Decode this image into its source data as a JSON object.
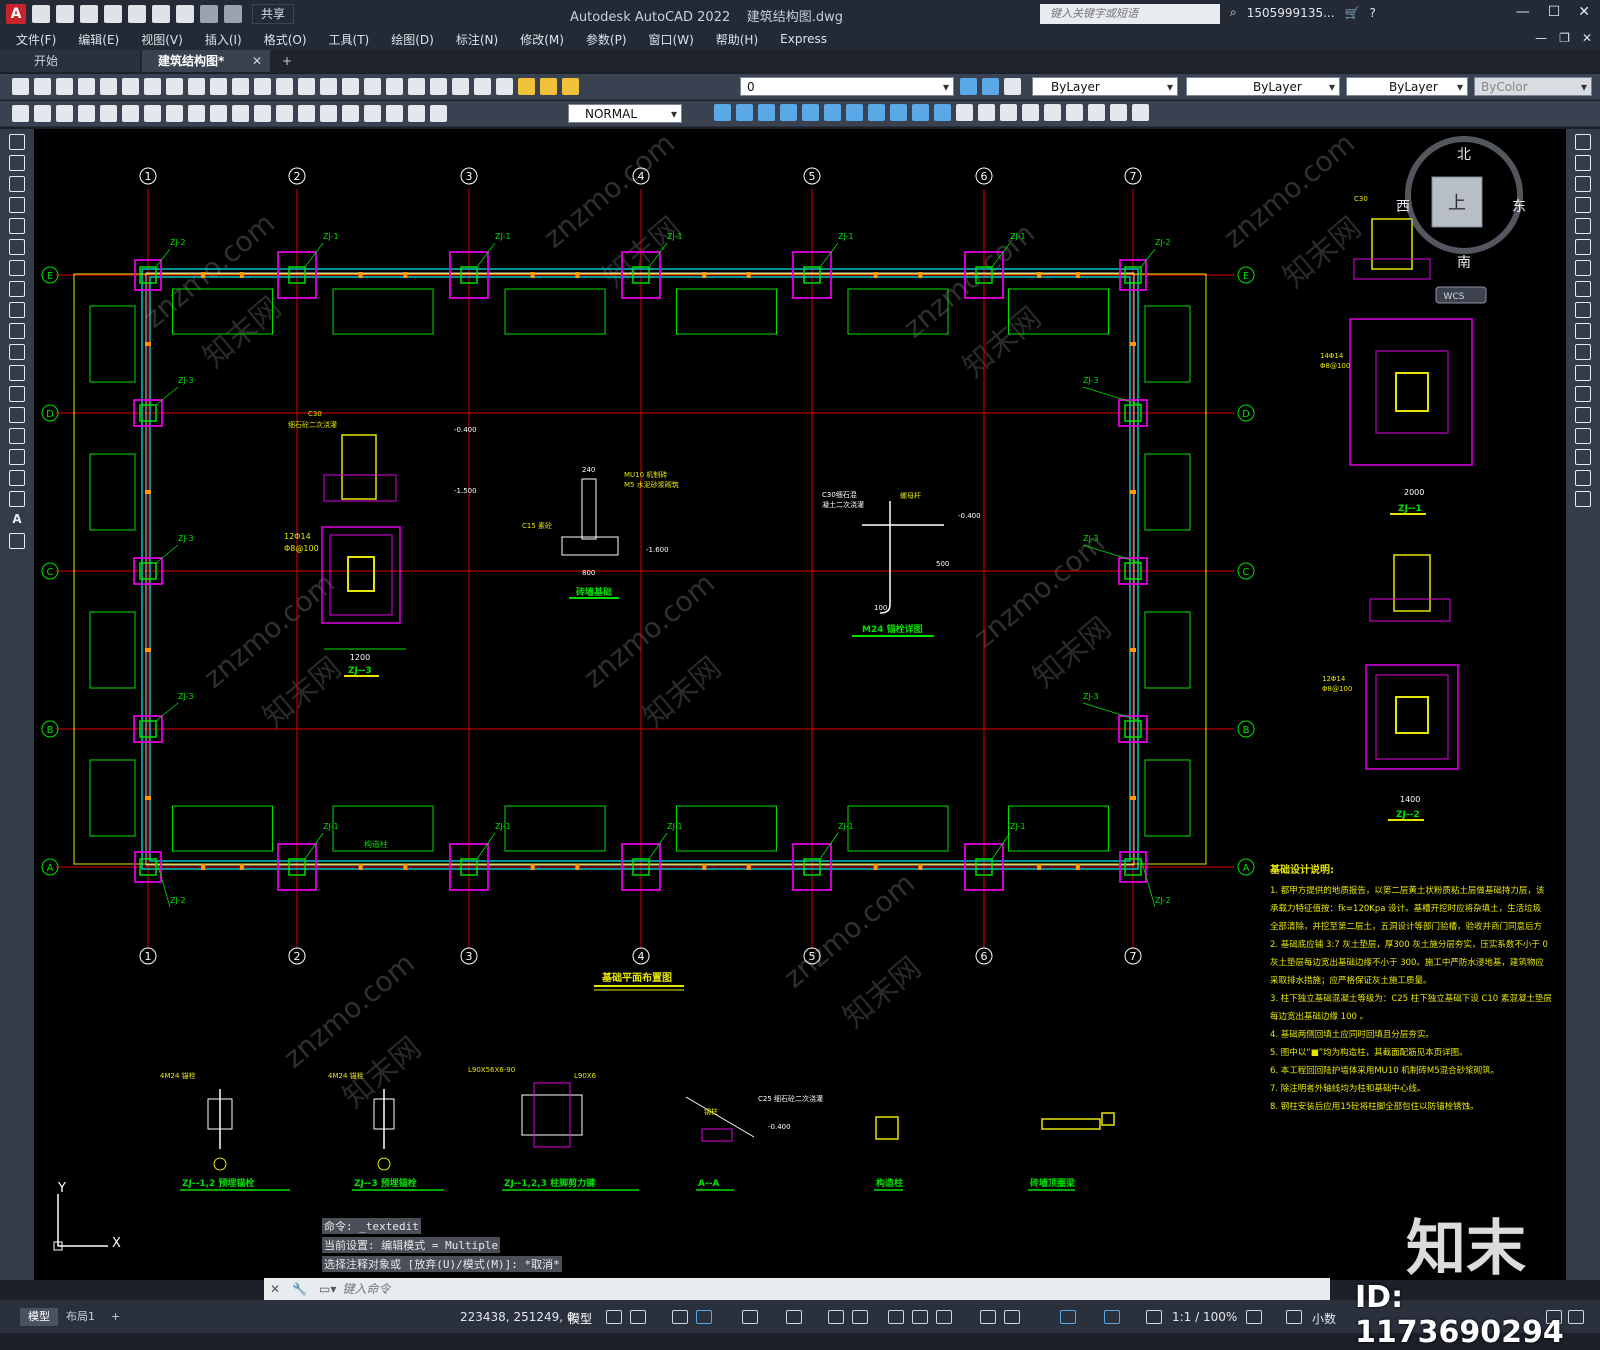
{
  "app": {
    "window_title": "Autodesk AutoCAD 2022",
    "file_name": "建筑结构图.dwg",
    "logo": "A",
    "share": "共享",
    "search_placeholder": "键入关键字或短语",
    "user": "1505999135...",
    "window_controls": [
      "—",
      "☐",
      "✕"
    ]
  },
  "menu": [
    "文件(F)",
    "编辑(E)",
    "视图(V)",
    "插入(I)",
    "格式(O)",
    "工具(T)",
    "绘图(D)",
    "标注(N)",
    "修改(M)",
    "参数(P)",
    "窗口(W)",
    "帮助(H)",
    "Express"
  ],
  "file_tabs": [
    {
      "label": "开始"
    },
    {
      "label": "建筑结构图*",
      "active": true
    }
  ],
  "toolbar": {
    "layer": "0",
    "color": "ByLayer",
    "linetype": "ByLayer",
    "lineweight": "ByLayer",
    "plotstyle": "ByColor",
    "dimstyle": "NORMAL"
  },
  "viewcube": {
    "north": "北",
    "south": "南",
    "east": "东",
    "west": "西",
    "top": "上",
    "wcs": "WCS"
  },
  "drawing": {
    "grid_numbers": [
      "1",
      "2",
      "3",
      "4",
      "5",
      "6",
      "7"
    ],
    "grid_letters": [
      "E",
      "D",
      "C",
      "B",
      "A"
    ],
    "main_title": "基础平面布置图",
    "labels": {
      "zj1": "ZJ-1",
      "zj2": "ZJ-2",
      "zj3": "ZJ-3",
      "gzz": "构造柱"
    },
    "detail_zj3": "ZJ--3",
    "detail_zj1": "ZJ--1",
    "detail_zj2": "ZJ--2",
    "brick_title": "砖墙基础",
    "anchor_title": "M24 锚栓详图",
    "detail_texts": {
      "c30": "C30",
      "c30b": "细石砼二次浇灌",
      "c15": "C15 素砼",
      "mu10": "MU10 机制砖",
      "m5": "M5 水泥砂浆砌筑",
      "n240": "240",
      "n800": "800",
      "n1200": "1200",
      "n2000": "2000",
      "n1400": "1400",
      "m0400": "-0.400",
      "m1500": "-1.500",
      "m1600": "-1.600",
      "r12": "12Φ14",
      "r14": "14Φ14",
      "rb": "Φ8@100",
      "c30m": "C30细石混",
      "c30n": "凝土二次浇灌",
      "mlj": "螺母杆",
      "n500": "500",
      "n100": "100"
    },
    "bottom_details": [
      "ZJ--1,2 预埋锚栓",
      "ZJ--3 预埋锚栓",
      "ZJ--1,2,3 柱脚剪力键",
      "A--A",
      "构造柱",
      "砖墙顶圈梁"
    ],
    "bottom_texts": {
      "m24a": "4M24 锚栓",
      "m24b": "4M24 锚栓",
      "l90a": "L90X56X6-90",
      "l90b": "L90X6",
      "gz": "钢柱",
      "c25": "C25 细石砼二次浇灌",
      "n0400": "-0.400"
    },
    "notes_title": "基础设计说明:",
    "notes": [
      "1. 都甲方提供的地质报告，以第二层黄土状粉质粘土层做基础持力层，该",
      "   承载力特征值按：fk=120Kpa 设计。基槽开挖时应将杂填土，生活垃圾",
      "   全部清除，并挖至第二层土，五洞设计等部门验槽，验收并商门同意后方",
      "2. 基础底应铺 3:7 灰土垫层，厚300 灰土施分层夯实，压实系数不小于 0",
      "   灰土垫层每边宽出基础边缘不小于 300。施工中严防水浸地基，建筑物应",
      "   采取排水措施；应严格保证灰土施工质量。",
      "3. 柱下独立基础混凝土等级为：C25 柱下独立基础下设 C10 素混凝土垫层",
      "   每边宽出基础边缘 100 。",
      "4. 基础两侧回填土应同时回填且分层夯实。",
      "5. 图中以“■”均为构造柱，其截面配筋见本页详图。",
      "6. 本工程回回陆护墙体采用MU10 机制砖M5混合砂浆砌筑。",
      "7. 除注明者外轴线均为柱和基础中心线。",
      "8. 钢柱安装后应用15砼将柱脚全部包住以防锚栓锈蚀。"
    ],
    "ucs": {
      "x": "X",
      "y": "Y"
    }
  },
  "command": {
    "history": [
      "命令: _textedit",
      "当前设置: 编辑模式 = Multiple",
      "选择注释对象或 [放弃(U)/模式(M)]: *取消*"
    ],
    "placeholder": "键入命令"
  },
  "status": {
    "layout_tabs": [
      "模型",
      "布局1"
    ],
    "coords": "223438, 251249, 0",
    "model": "模型",
    "scale": "1:1 / 100%",
    "units": "小数"
  },
  "watermark": {
    "logo": "知末",
    "id": "ID: 1173690294",
    "site": "znzmo.com",
    "cn": "知末网"
  }
}
